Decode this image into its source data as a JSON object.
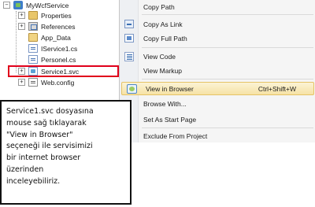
{
  "solution_explorer": {
    "project": "MyWcfService",
    "items": [
      {
        "label": "Properties",
        "icon": "folder-icon",
        "expandable": true
      },
      {
        "label": "References",
        "icon": "references-icon",
        "expandable": true
      },
      {
        "label": "App_Data",
        "icon": "folder-open-icon",
        "expandable": false
      },
      {
        "label": "IService1.cs",
        "icon": "cs-file-icon",
        "expandable": false
      },
      {
        "label": "Personel.cs",
        "icon": "cs-file-icon",
        "expandable": false
      },
      {
        "label": "Service1.svc",
        "icon": "svc-file-icon",
        "expandable": true,
        "highlighted": true
      },
      {
        "label": "Web.config",
        "icon": "config-file-icon",
        "expandable": true
      }
    ]
  },
  "context_menu": {
    "items": [
      {
        "label": "Copy Path",
        "icon": "",
        "shortcut": ""
      },
      {
        "label": "Copy As Link",
        "icon": "copy-link-icon",
        "shortcut": ""
      },
      {
        "label": "Copy Full Path",
        "icon": "copy-path-icon",
        "shortcut": ""
      },
      {
        "label": "View Code",
        "icon": "view-code-icon",
        "shortcut": ""
      },
      {
        "label": "View Markup",
        "icon": "",
        "shortcut": ""
      },
      {
        "label": "View in Browser",
        "icon": "view-in-browser-icon",
        "shortcut": "Ctrl+Shift+W",
        "highlighted": true
      },
      {
        "label": "Browse With...",
        "icon": "",
        "shortcut": ""
      },
      {
        "label": "Set As Start Page",
        "icon": "",
        "shortcut": ""
      },
      {
        "label": "Exclude From Project",
        "icon": "",
        "shortcut": ""
      }
    ]
  },
  "note": {
    "text": "Service1.svc dosyasına\nmouse sağ tıklayarak\n\"View in Browser\"\nseçeneği ile servisimizi\nbir internet browser\nüzerinden\ninceleyebiliriz."
  },
  "colors": {
    "highlight_border": "#e0001b",
    "menu_hover": "#f6e2a5"
  }
}
